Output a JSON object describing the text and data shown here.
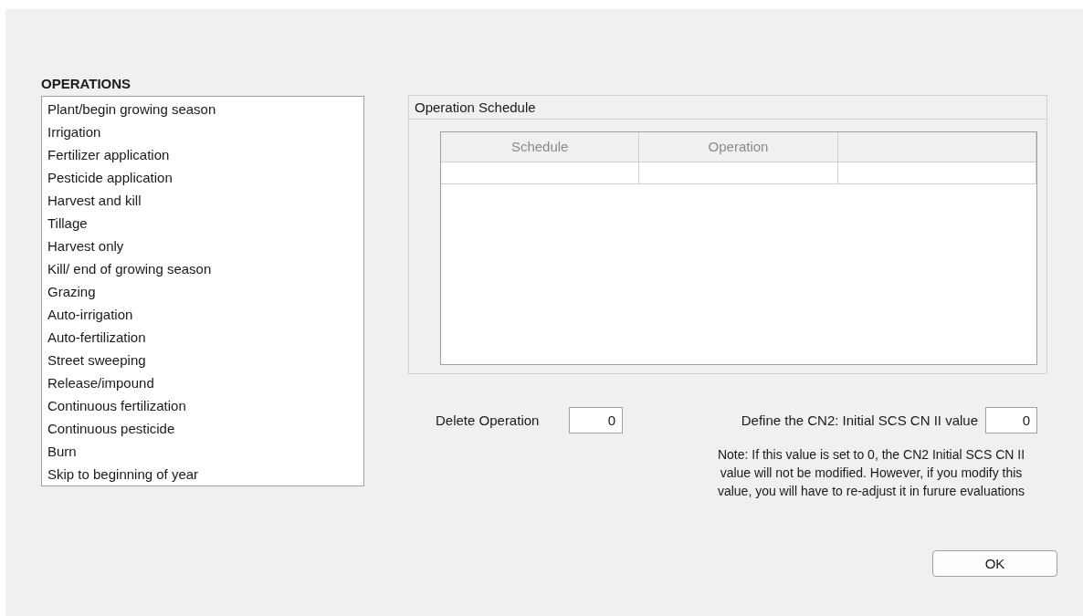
{
  "operations": {
    "title": "OPERATIONS",
    "items": [
      "Plant/begin growing season",
      "Irrigation",
      "Fertilizer application",
      "Pesticide application",
      "Harvest and kill",
      "Tillage",
      "Harvest only",
      "Kill/ end of growing season",
      "Grazing",
      "Auto-irrigation",
      "Auto-fertilization",
      "Street sweeping",
      "Release/impound",
      "Continuous fertilization",
      "Continuous pesticide",
      "Burn",
      "Skip to beginning of year"
    ]
  },
  "schedule": {
    "title": "Operation Schedule",
    "columns": [
      "Schedule",
      "Operation",
      null
    ]
  },
  "delete_operation": {
    "label": "Delete Operation",
    "value": "0"
  },
  "cn2": {
    "label": "Define the CN2: Initial SCS CN II value",
    "value": "0",
    "note": "Note: If this value is set to 0, the CN2 Initial SCS CN II value will not be modified. However, if you modify this value, you will have to re-adjust it in furure evaluations"
  },
  "buttons": [
    "OK"
  ]
}
